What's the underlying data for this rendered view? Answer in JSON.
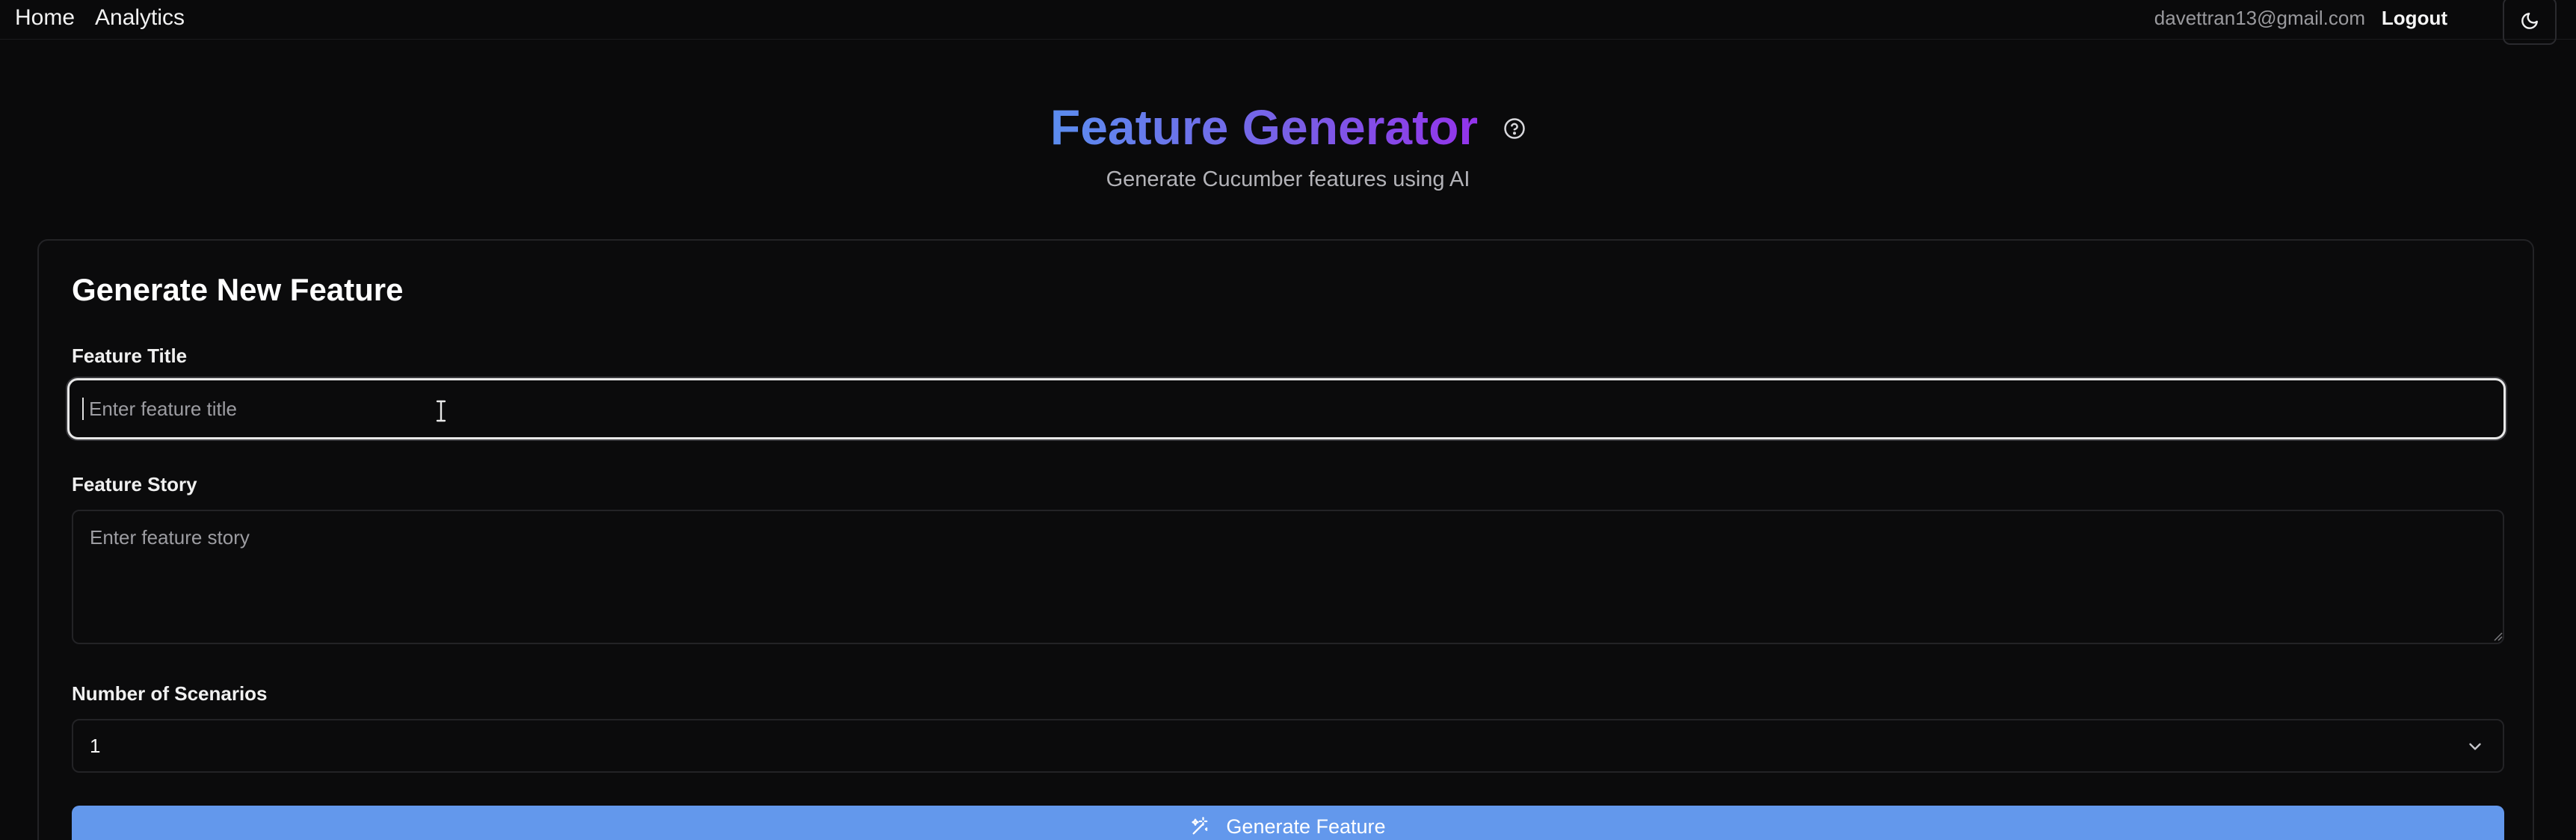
{
  "nav": {
    "links": [
      "Home",
      "Analytics"
    ],
    "user_email": "davettran13@gmail.com",
    "logout_label": "Logout",
    "theme_icon": "moon-icon"
  },
  "hero": {
    "title": "Feature Generator",
    "subtitle": "Generate Cucumber features using AI",
    "help_icon": "help-circle-icon"
  },
  "form": {
    "heading": "Generate New Feature",
    "title_field": {
      "label": "Feature Title",
      "placeholder": "Enter feature title",
      "value": ""
    },
    "story_field": {
      "label": "Feature Story",
      "placeholder": "Enter feature story",
      "value": ""
    },
    "scenarios_field": {
      "label": "Number of Scenarios",
      "selected": "1"
    },
    "submit": {
      "label": "Generate Feature",
      "icon": "magic-wand-icon"
    }
  },
  "colors": {
    "background": "#0a0a0b",
    "accent_button": "#6398ec",
    "title_gradient_start": "#5b8def",
    "title_gradient_end": "#9333ea"
  }
}
